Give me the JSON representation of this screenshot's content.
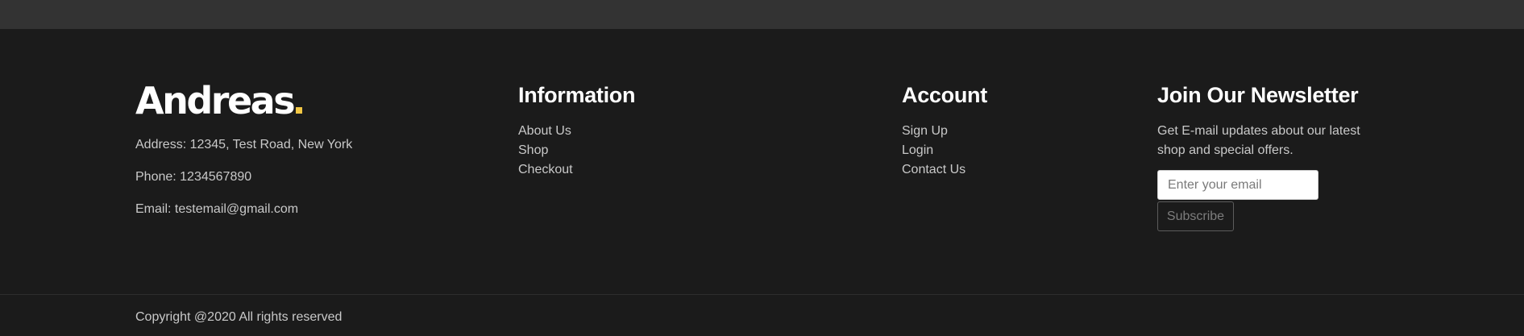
{
  "brand": {
    "name": "Andreas",
    "accent_color": "#f2c744",
    "address": "Address: 12345, Test Road, New York",
    "phone": "Phone: 1234567890",
    "email": "Email: testemail@gmail.com"
  },
  "information": {
    "heading": "Information",
    "links": [
      "About Us",
      "Shop",
      "Checkout"
    ]
  },
  "account": {
    "heading": "Account",
    "links": [
      "Sign Up",
      "Login",
      "Contact Us"
    ]
  },
  "newsletter": {
    "heading": "Join Our Newsletter",
    "description": "Get E-mail updates about our latest shop and special offers.",
    "email_placeholder": "Enter your email",
    "email_value": "",
    "subscribe_label": "Subscribe"
  },
  "copyright": "Copyright @2020 All rights reserved"
}
